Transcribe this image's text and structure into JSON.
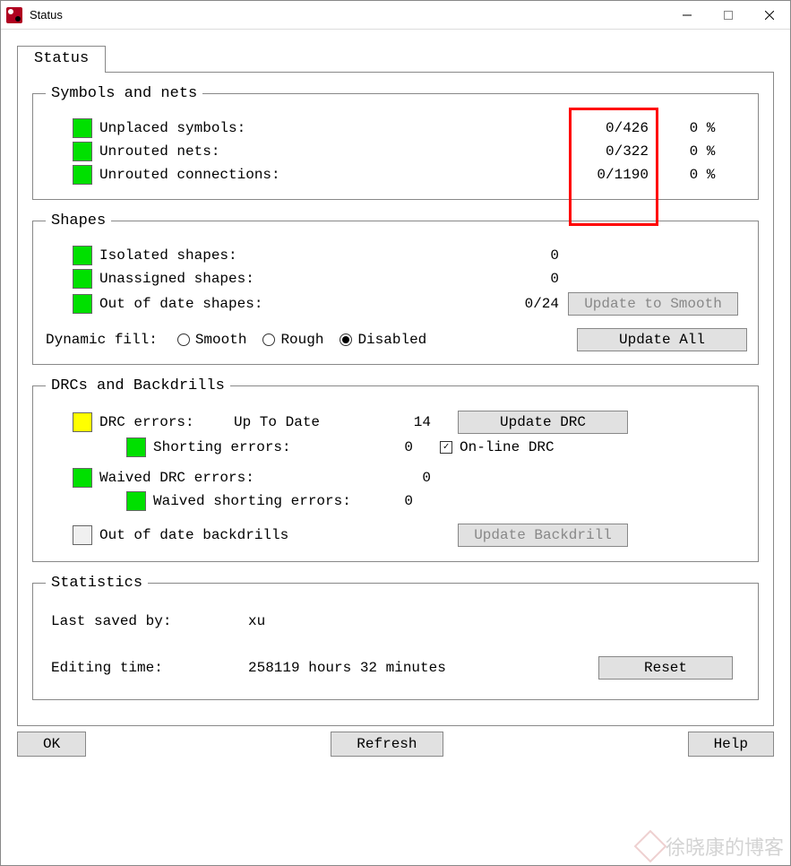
{
  "window": {
    "title": "Status"
  },
  "tab": {
    "label": "Status"
  },
  "symbols_nets": {
    "legend": "Symbols and nets",
    "rows": [
      {
        "label": "Unplaced symbols:",
        "value": "0/426",
        "pct": "0 %"
      },
      {
        "label": "Unrouted nets:",
        "value": "0/322",
        "pct": "0 %"
      },
      {
        "label": "Unrouted connections:",
        "value": "0/1190",
        "pct": "0 %"
      }
    ]
  },
  "shapes": {
    "legend": "Shapes",
    "rows": [
      {
        "label": "Isolated shapes:",
        "value": "0"
      },
      {
        "label": "Unassigned shapes:",
        "value": "0"
      },
      {
        "label": "Out of date shapes:",
        "value": "0/24",
        "btn": "Update to Smooth"
      }
    ],
    "dynamic_fill_label": "Dynamic fill:",
    "options": {
      "smooth": "Smooth",
      "rough": "Rough",
      "disabled": "Disabled"
    },
    "selected": "disabled",
    "update_all": "Update All"
  },
  "drcs": {
    "legend": "DRCs and Backdrills",
    "drc_errors_label": "DRC errors:",
    "drc_status": "Up To Date",
    "drc_value": "14",
    "update_drc": "Update DRC",
    "shorting_label": "Shorting errors:",
    "shorting_value": "0",
    "online_drc_label": "On-line DRC",
    "online_drc_checked": true,
    "waived_label": "Waived DRC errors:",
    "waived_value": "0",
    "waived_shorting_label": "Waived shorting errors:",
    "waived_shorting_value": "0",
    "backdrill_label": "Out of date backdrills",
    "update_backdrill": "Update Backdrill"
  },
  "stats": {
    "legend": "Statistics",
    "saved_label": "Last saved by:",
    "saved_value": "xu",
    "edit_label": "Editing time:",
    "edit_value": "258119 hours 32 minutes",
    "reset": "Reset"
  },
  "buttons": {
    "ok": "OK",
    "refresh": "Refresh",
    "help": "Help"
  },
  "watermark": "徐晓康的博客"
}
